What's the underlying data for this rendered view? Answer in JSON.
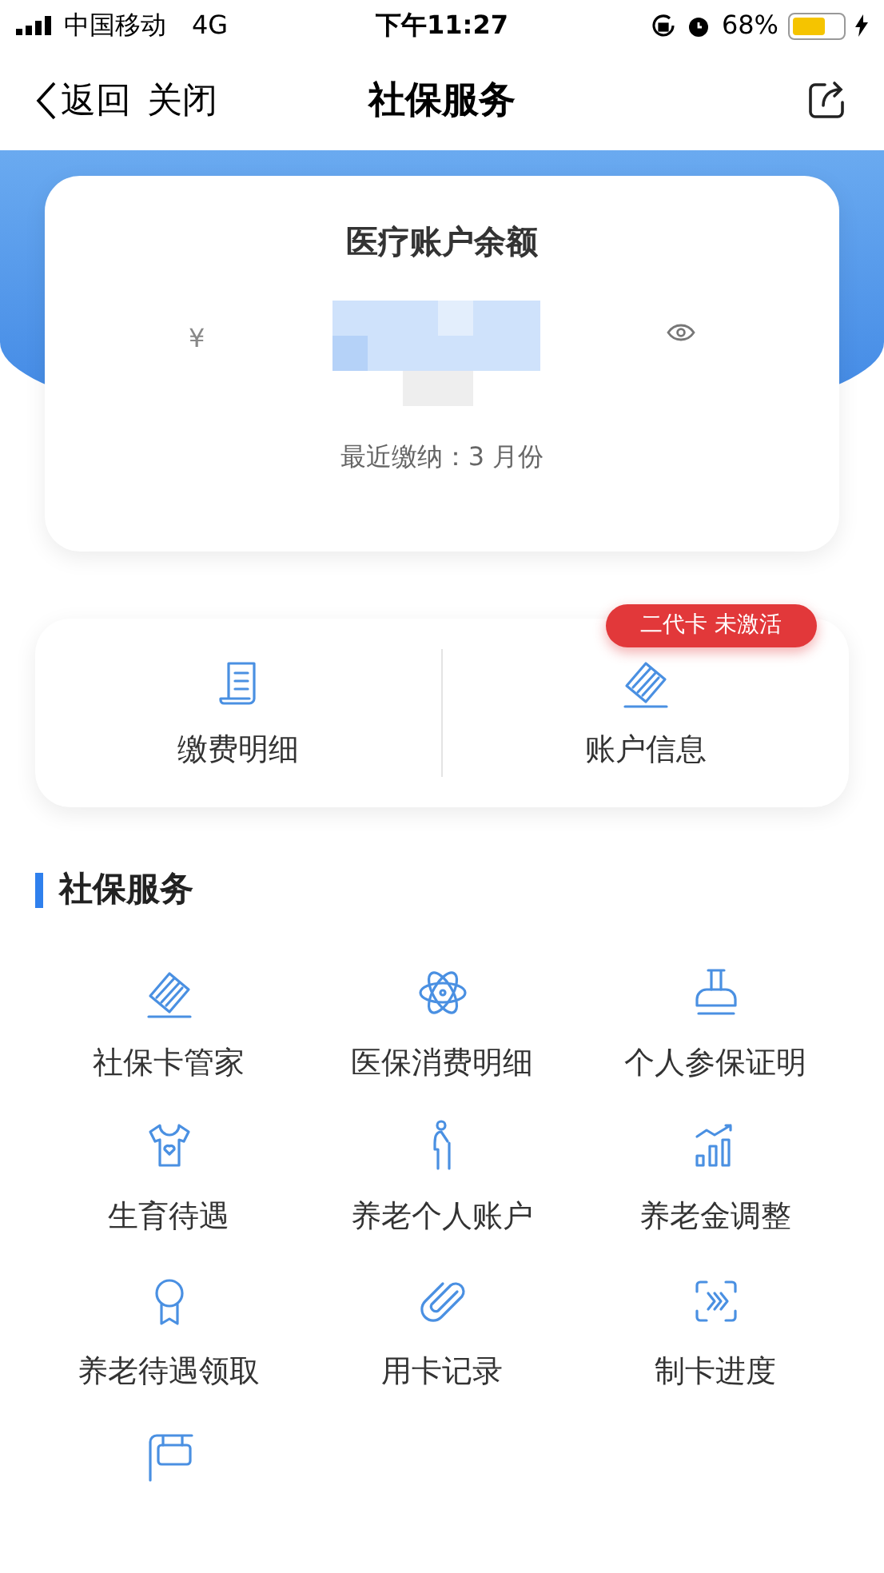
{
  "status_bar": {
    "carrier": "中国移动",
    "network": "4G",
    "time": "下午11:27",
    "battery": "68%"
  },
  "nav": {
    "back": "返回",
    "close": "关闭",
    "title": "社保服务"
  },
  "balance_card": {
    "title": "医疗账户余额",
    "currency": "¥",
    "last_payment": "最近缴纳：3 月份"
  },
  "shortcuts": [
    {
      "label": "缴费明细"
    },
    {
      "label": "账户信息",
      "badge": "二代卡 未激活"
    }
  ],
  "section": {
    "title": "社保服务"
  },
  "services": [
    {
      "kind": "tile",
      "label": "社保卡管家"
    },
    {
      "kind": "tile",
      "label": "医保消费明细"
    },
    {
      "kind": "tile",
      "label": "个人参保证明"
    },
    {
      "kind": "tile",
      "label": "生育待遇"
    },
    {
      "kind": "tile",
      "label": "养老个人账户"
    },
    {
      "kind": "tile",
      "label": "养老金调整"
    },
    {
      "kind": "tile",
      "label": "养老待遇领取"
    },
    {
      "kind": "tile",
      "label": "用卡记录"
    },
    {
      "kind": "tile",
      "label": "制卡进度"
    },
    {
      "kind": "icon_only"
    }
  ]
}
